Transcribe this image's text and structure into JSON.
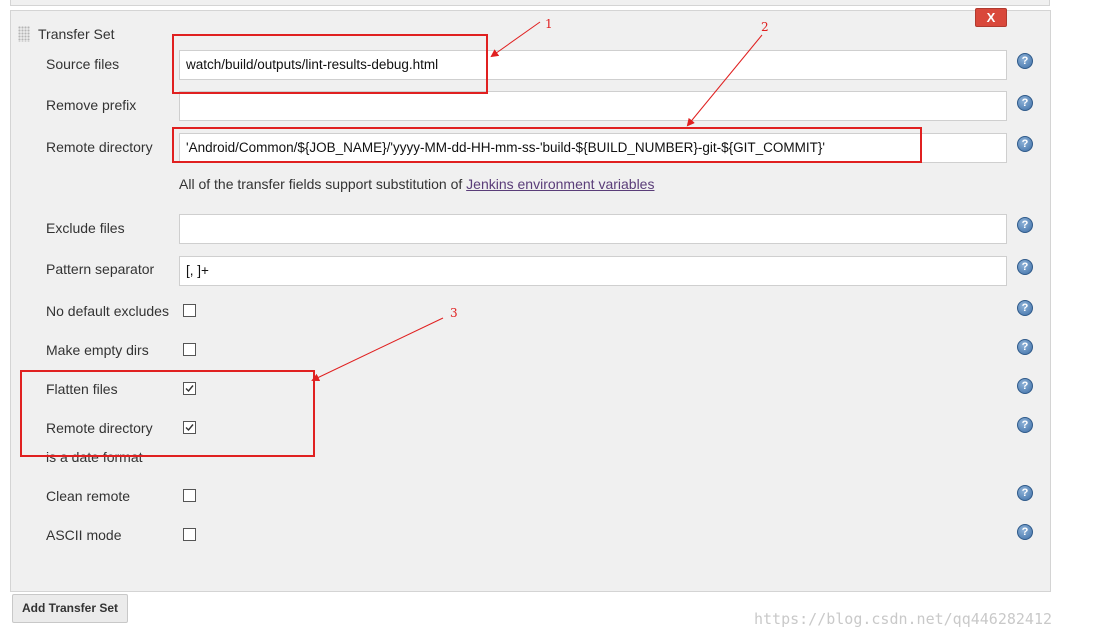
{
  "section": {
    "title": "Transfer Set",
    "close_label": "X"
  },
  "fields": {
    "source_files": {
      "label": "Source files",
      "value": "watch/build/outputs/lint-results-debug.html"
    },
    "remove_prefix": {
      "label": "Remove prefix",
      "value": ""
    },
    "remote_directory": {
      "label": "Remote directory",
      "value": "'Android/Common/${JOB_NAME}/'yyyy-MM-dd-HH-mm-ss-'build-${BUILD_NUMBER}-git-${GIT_COMMIT}'"
    },
    "exclude_files": {
      "label": "Exclude files",
      "value": ""
    },
    "pattern_separator": {
      "label": "Pattern separator",
      "value": "[, ]+"
    }
  },
  "hint": {
    "text": "All of the transfer fields support substitution of ",
    "link": "Jenkins environment variables"
  },
  "checkboxes": {
    "no_default_excludes": {
      "label": "No default excludes",
      "checked": false
    },
    "make_empty_dirs": {
      "label": "Make empty dirs",
      "checked": false
    },
    "flatten_files": {
      "label": "Flatten files",
      "checked": true
    },
    "remote_dir_date": {
      "label_line1": "Remote directory",
      "label_line2": "is a date format",
      "checked": true
    },
    "clean_remote": {
      "label": "Clean remote",
      "checked": false
    },
    "ascii_mode": {
      "label": "ASCII mode",
      "checked": false
    }
  },
  "help_symbol": "?",
  "add_button": "Add Transfer Set",
  "watermark": "https://blog.csdn.net/qq446282412",
  "annotations": {
    "n1": "1",
    "n2": "2",
    "n3": "3"
  },
  "colors": {
    "annotation": "#e02020",
    "panel": "#f0f0f0",
    "link": "#5a3d79",
    "close": "#d9483b"
  }
}
